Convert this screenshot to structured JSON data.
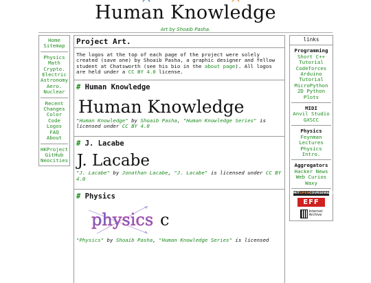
{
  "site": {
    "title_parts": [
      "Hum",
      "a",
      "n Knowl",
      "e",
      "dge"
    ],
    "byline": "Art by Shoaib Pasha."
  },
  "leftnav": {
    "groups": [
      [
        "Home",
        "Sitemap"
      ],
      [
        "Physics",
        "Math",
        "Crypto.",
        "Electric",
        "Astronomy",
        "Aero.",
        "Nuclear"
      ],
      [
        "Recent",
        "Changes",
        "Color",
        "Code",
        "Logos",
        "FAQ",
        "About"
      ],
      [
        "HKProject",
        "GitHub",
        "Neocities"
      ]
    ]
  },
  "main": {
    "title": "Project Art.",
    "intro": {
      "t1": "The logos at the top of each page of the project were solely created (save one) by Shoaib Pasha, a graphic designer and fellow student at Chatsworth (see his bio in the ",
      "link1": "about page",
      "t2": "). All logos are held under a ",
      "link2": "CC BY 4.0",
      "t3": " license."
    },
    "sections": [
      {
        "hash": "#",
        "heading": "Human Knowledge",
        "logo_text": "Human Knowledge",
        "work": "\"Human Knowledge\"",
        "by": " by ",
        "author": "Shoaib Pasha",
        "comma": ", ",
        "series": "\"Human Knowledge Series\"",
        "lic_pre": " is licensed under ",
        "license": "CC BY 4.0"
      },
      {
        "hash": "#",
        "heading": "J. Lacabe",
        "logo_text": "J. Lacabe",
        "work": "\"J. Lacabe\"",
        "by": " by ",
        "author": "Jonathan Lacabe",
        "comma": ", ",
        "series": "\"J. Lacabe\"",
        "lic_pre": " is licensed under ",
        "license": "CC BY 4.0"
      },
      {
        "hash": "#",
        "heading": "Physics",
        "logo_text": "physics",
        "logo_suffix": "c",
        "work": "\"Physics\"",
        "by": " by ",
        "author": "Shoaib Pasha",
        "comma": ", ",
        "series": "\"Human Knowledge Series\"",
        "lic_pre": " is licensed",
        "license": ""
      }
    ]
  },
  "rightnav": {
    "header": "links",
    "groups": [
      {
        "title": "Programming",
        "links": [
          "Short C++",
          "Tutorial",
          "Codeforces",
          "Arduino",
          "Tutorial",
          "MicroPython",
          "2D Python",
          "Plots"
        ]
      },
      {
        "title": "MIDI",
        "links": [
          "Anvil Studio",
          "GXSCC"
        ]
      },
      {
        "title": "Physics",
        "links": [
          "Feynman",
          "Lectures",
          "Physics",
          "Intro."
        ]
      },
      {
        "title": "Aggregators",
        "links": [
          "Hacker News",
          "Web Curios",
          "Waxy"
        ]
      }
    ],
    "badges": {
      "mit_a": "MIT",
      "mit_b": "OPEN",
      "mit_c": "COURSEWARE",
      "eff": "EFF",
      "ia_line1": "Internet",
      "ia_line2": "Archive"
    }
  },
  "colors": {
    "link": "#1a8a1a",
    "hat_blue": "#2a5db0",
    "hat_orange": "#e07a1a",
    "eff_red": "#d02020"
  }
}
